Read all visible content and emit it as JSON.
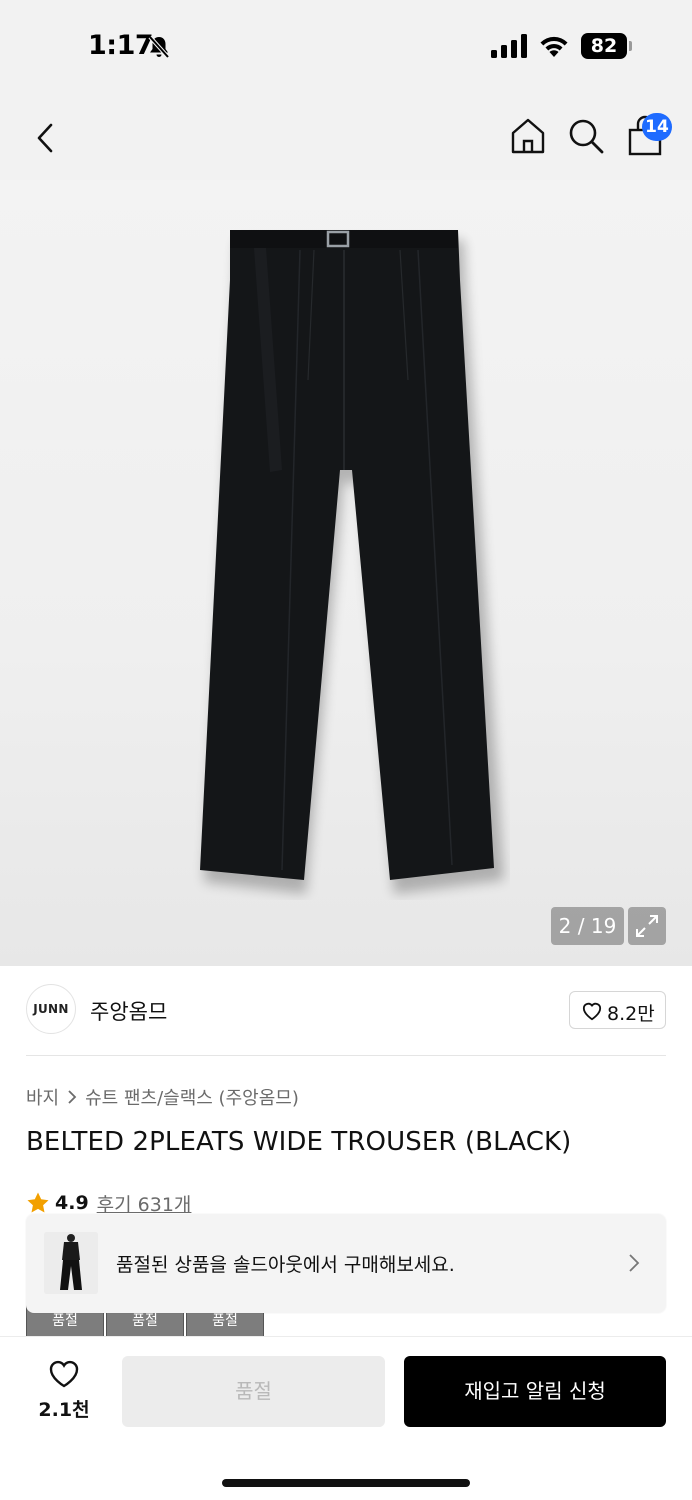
{
  "status_bar": {
    "time": "1:17",
    "battery": "82"
  },
  "header": {
    "cart_count": "14"
  },
  "gallery": {
    "counter": "2 / 19"
  },
  "brand": {
    "logo_text": "JUNN",
    "name": "주앙옴므",
    "like_count": "8.2만"
  },
  "breadcrumb": {
    "category": "바지",
    "subcategory": "슈트 팬츠/슬랙스 (주앙옴므)"
  },
  "product": {
    "title": "BELTED 2PLEATS WIDE TROUSER (BLACK)",
    "rating": "4.9",
    "reviews": "후기 631개"
  },
  "thumbnails": [
    "품절",
    "품절",
    "품절"
  ],
  "banner": {
    "text": "품절된 상품을 솔드아웃에서 구매해보세요."
  },
  "bottom_bar": {
    "wish_count": "2.1천",
    "soldout_label": "품절",
    "restock_label": "재입고 알림 신청"
  },
  "colors": {
    "accent_badge": "#1e6bff",
    "star": "#f2a000",
    "primary_button": "#000000"
  }
}
